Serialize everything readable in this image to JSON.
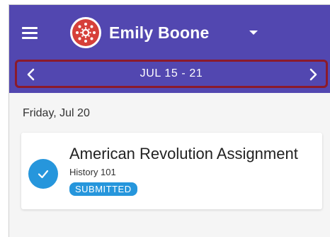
{
  "colors": {
    "app_bar": "#5247b0",
    "week_highlight_border": "#8b1a2b",
    "accent_blue": "#2696dc",
    "avatar_red": "#d6403a",
    "background": "#f5f5f5"
  },
  "header": {
    "menu_icon": "hamburger-menu-icon",
    "avatar_icon": "canvas-logo-icon",
    "user_name": "Emily Boone",
    "dropdown_icon": "caret-down-icon"
  },
  "week_nav": {
    "prev_icon": "chevron-left-icon",
    "label": "JUL 15 - 21",
    "next_icon": "chevron-right-icon"
  },
  "day": {
    "heading": "Friday, Jul 20",
    "items": [
      {
        "title": "American Revolution Assignment",
        "course": "History 101",
        "status": "SUBMITTED",
        "icon": "checkmark-circle-icon"
      }
    ]
  }
}
